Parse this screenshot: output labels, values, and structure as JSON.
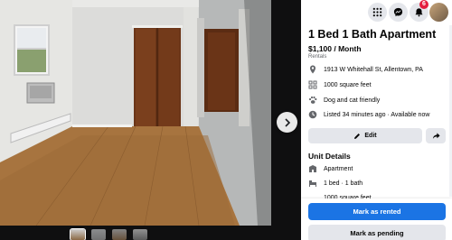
{
  "viewer": {
    "next_icon": "chevron-right-icon",
    "thumbnail_count": 4
  },
  "topbar": {
    "menu_icon": "grid-menu-icon",
    "messenger_icon": "messenger-icon",
    "notifications_icon": "bell-icon",
    "notification_count": "6"
  },
  "listing": {
    "title": "1 Bed 1 Bath Apartment",
    "price": "$1,100 / Month",
    "category": "Rentals",
    "details": [
      {
        "icon": "location-pin-icon",
        "text": "1913 W Whitehall St, Allentown, PA"
      },
      {
        "icon": "floorplan-icon",
        "text": "1000 square feet"
      },
      {
        "icon": "paw-icon",
        "text": "Dog and cat friendly"
      },
      {
        "icon": "clock-icon",
        "text": "Listed 34 minutes ago · Available now"
      }
    ],
    "edit_label": "Edit",
    "share_icon": "share-arrow-icon"
  },
  "unit_details": {
    "heading": "Unit Details",
    "items": [
      {
        "icon": "building-icon",
        "text": "Apartment"
      },
      {
        "icon": "bed-bath-icon",
        "text": "1 bed · 1 bath"
      }
    ],
    "partial_text": "1000 square feet"
  },
  "actions": {
    "mark_rented": "Mark as rented",
    "mark_pending": "Mark as pending"
  },
  "colors": {
    "primary": "#1b74e4",
    "secondary_bg": "#e4e6eb",
    "badge": "#e41e3f"
  }
}
